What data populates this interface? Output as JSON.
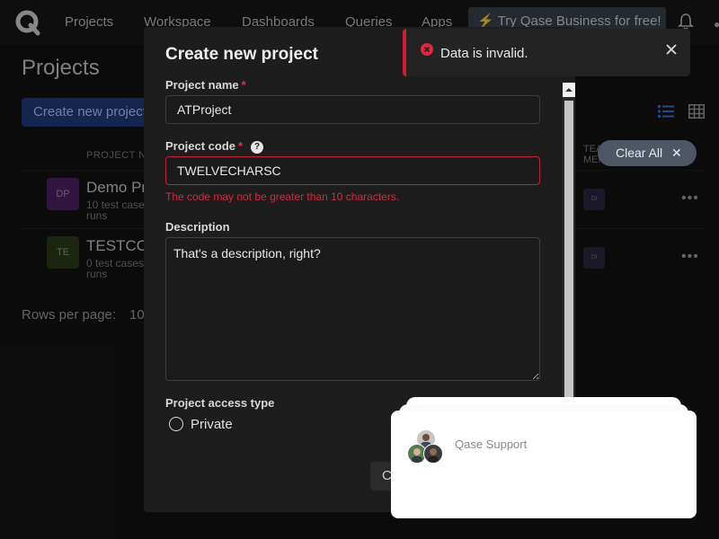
{
  "app": {
    "nav": [
      "Projects",
      "Workspace",
      "Dashboards",
      "Queries",
      "Apps"
    ],
    "promo": "Try Qase Business for free!",
    "page_title": "Projects",
    "create_button": "Create new project",
    "columns": {
      "project_name": "PROJECT NAME",
      "team": "TEAM MEMBERS"
    },
    "projects": [
      {
        "abbr": "DP",
        "name": "Demo Project",
        "sub1": "10 test cases",
        "sub2": "runs",
        "member": "DI",
        "color": "#5a2a70"
      },
      {
        "abbr": "TE",
        "name": "TESTCODE",
        "sub1": "0 test cases",
        "sub2": "runs",
        "member": "DI",
        "color": "#3a4a1f"
      }
    ],
    "rows_per_page_label": "Rows per page:",
    "rows_per_page_value": "10"
  },
  "modal": {
    "title": "Create new project",
    "project_name_label": "Project name",
    "project_name_value": "ATProject",
    "project_code_label": "Project code",
    "help_glyph": "?",
    "project_code_value": "TWELVECHARSC",
    "code_error": "The code may not be greater than 10 characters.",
    "description_label": "Description",
    "description_value": "That's a description, right?",
    "access_type_label": "Project access type",
    "access_private": "Private",
    "partial_button": "Cancel"
  },
  "toast": {
    "message": "Data is invalid."
  },
  "filters": {
    "clear_all": "Clear All"
  },
  "support": {
    "name": "Qase Support"
  },
  "colors": {
    "error": "#d01c35",
    "accent": "#1f3a78",
    "modal_bg": "#1d1d1d"
  }
}
